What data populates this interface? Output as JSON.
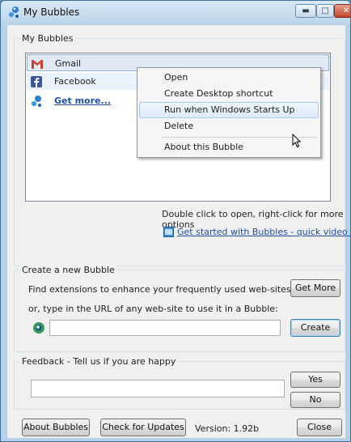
{
  "window": {
    "title": "My Bubbles"
  },
  "bubbles_group": {
    "label": "My Bubbles",
    "items": [
      {
        "label": "Gmail",
        "icon": "gmail-icon"
      },
      {
        "label": "Facebook",
        "icon": "facebook-icon"
      },
      {
        "label": "Get more...",
        "icon": "bubbles-icon"
      }
    ],
    "hint": "Double click to open, right-click for more options",
    "tutorial_link": "Get started with Bubbles - quick video tutorial"
  },
  "context_menu": {
    "items": [
      "Open",
      "Create Desktop shortcut",
      "Run when Windows Starts Up",
      "Delete",
      "About this Bubble"
    ]
  },
  "create_group": {
    "label": "Create a new Bubble",
    "find_text": "Find extensions to enhance your frequently used web-sites",
    "get_more_label": "Get More",
    "url_text": "or, type in the URL of any web-site to use it in a Bubble:",
    "url_value": "",
    "create_label": "Create"
  },
  "feedback_group": {
    "label": "Feedback  -  Tell us if you are happy",
    "value": "",
    "yes_label": "Yes",
    "no_label": "No"
  },
  "footer": {
    "about_label": "About Bubbles",
    "updates_label": "Check for Updates",
    "version": "Version: 1.92b",
    "close_label": "Close"
  },
  "colors": {
    "link": "#1f4ea3",
    "selection": "#e0eaf5",
    "title_bar": "#bdd6eb"
  }
}
